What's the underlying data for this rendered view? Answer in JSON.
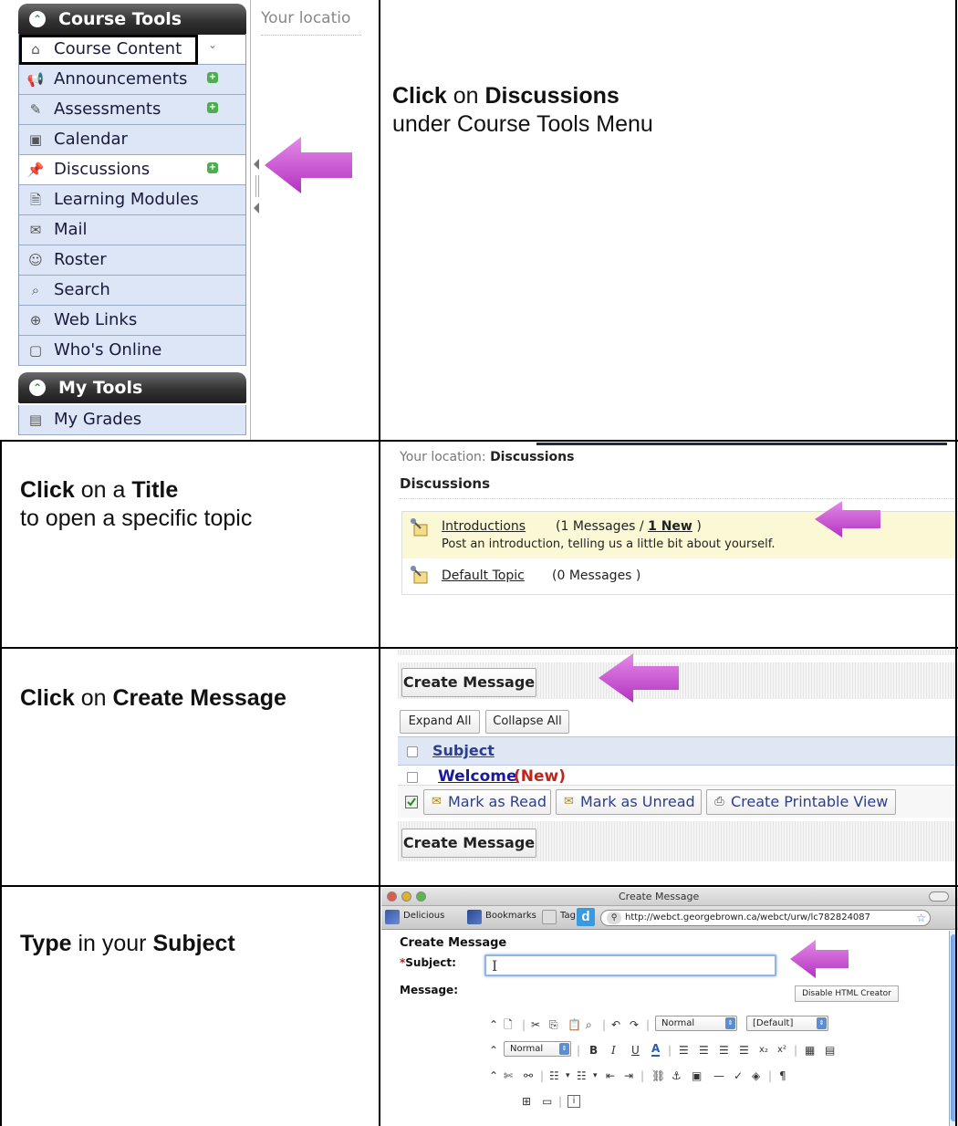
{
  "steps": [
    {
      "action": "Click",
      "connector": "on",
      "target": "Discussions",
      "line2": "under Course Tools Menu"
    },
    {
      "action": "Click",
      "connector": "on a",
      "target": "Title",
      "line2": "to open a specific topic"
    },
    {
      "action": "Click",
      "connector": "on",
      "target": "Create Message",
      "line2": ""
    },
    {
      "action": "Type",
      "connector": "in your",
      "target": "Subject",
      "line2": ""
    }
  ],
  "colors": {
    "arrow": "#cc55d6",
    "menu_header": "#2b2b2b",
    "menu_item_bg": "#dce6f6",
    "topic_highlight": "#fbf8d6",
    "new_tag": "#c0251a"
  },
  "panel1": {
    "course_tools_header": "Course Tools",
    "my_tools_header": "My Tools",
    "location_text": "Your locatio",
    "menu_items": [
      {
        "label": "Course Content",
        "icon": "home-icon"
      },
      {
        "label": "Announcements",
        "icon": "megaphone-icon"
      },
      {
        "label": "Assessments",
        "icon": "assessment-icon"
      },
      {
        "label": "Calendar",
        "icon": "calendar-icon"
      },
      {
        "label": "Discussions",
        "icon": "pushpin-icon"
      },
      {
        "label": "Learning Modules",
        "icon": "document-icon"
      },
      {
        "label": "Mail",
        "icon": "envelope-icon"
      },
      {
        "label": "Roster",
        "icon": "people-icon"
      },
      {
        "label": "Search",
        "icon": "magnifier-icon"
      },
      {
        "label": "Web Links",
        "icon": "globe-icon"
      },
      {
        "label": "Who's Online",
        "icon": "person-card-icon"
      }
    ],
    "my_tools_items": [
      {
        "label": "My Grades",
        "icon": "grades-icon"
      }
    ]
  },
  "panel2": {
    "location_label": "Your location:",
    "location_value": "Discussions",
    "heading": "Discussions",
    "topics": [
      {
        "title": "Introductions",
        "count_text": "(1 Messages /",
        "new_text": "1 New",
        "close_paren": ")",
        "description": "Post an introduction, telling us a little bit about yourself."
      },
      {
        "title": "Default Topic",
        "count_text": "(0 Messages )"
      }
    ]
  },
  "panel3": {
    "create_message": "Create Message",
    "expand_all": "Expand All",
    "collapse_all": "Collapse All",
    "subject_header": "Subject",
    "message_subject": "Welcome",
    "new_tag": "(New)",
    "mark_read": "Mark as Read",
    "mark_unread": "Mark as Unread",
    "printable_view": "Create Printable View"
  },
  "panel4": {
    "window_title": "Create Message",
    "bookmarks": [
      "Delicious",
      "Bookmarks",
      "Tag"
    ],
    "url": "http://webct.georgebrown.ca/webct/urw/lc782824087",
    "form_heading": "Create Message",
    "subject_required_mark": "*",
    "subject_label": "Subject:",
    "message_label": "Message:",
    "disable_html": "Disable HTML Creator",
    "paragraph_select": "Normal",
    "font_select": "[Default]",
    "size_select": "Normal"
  }
}
